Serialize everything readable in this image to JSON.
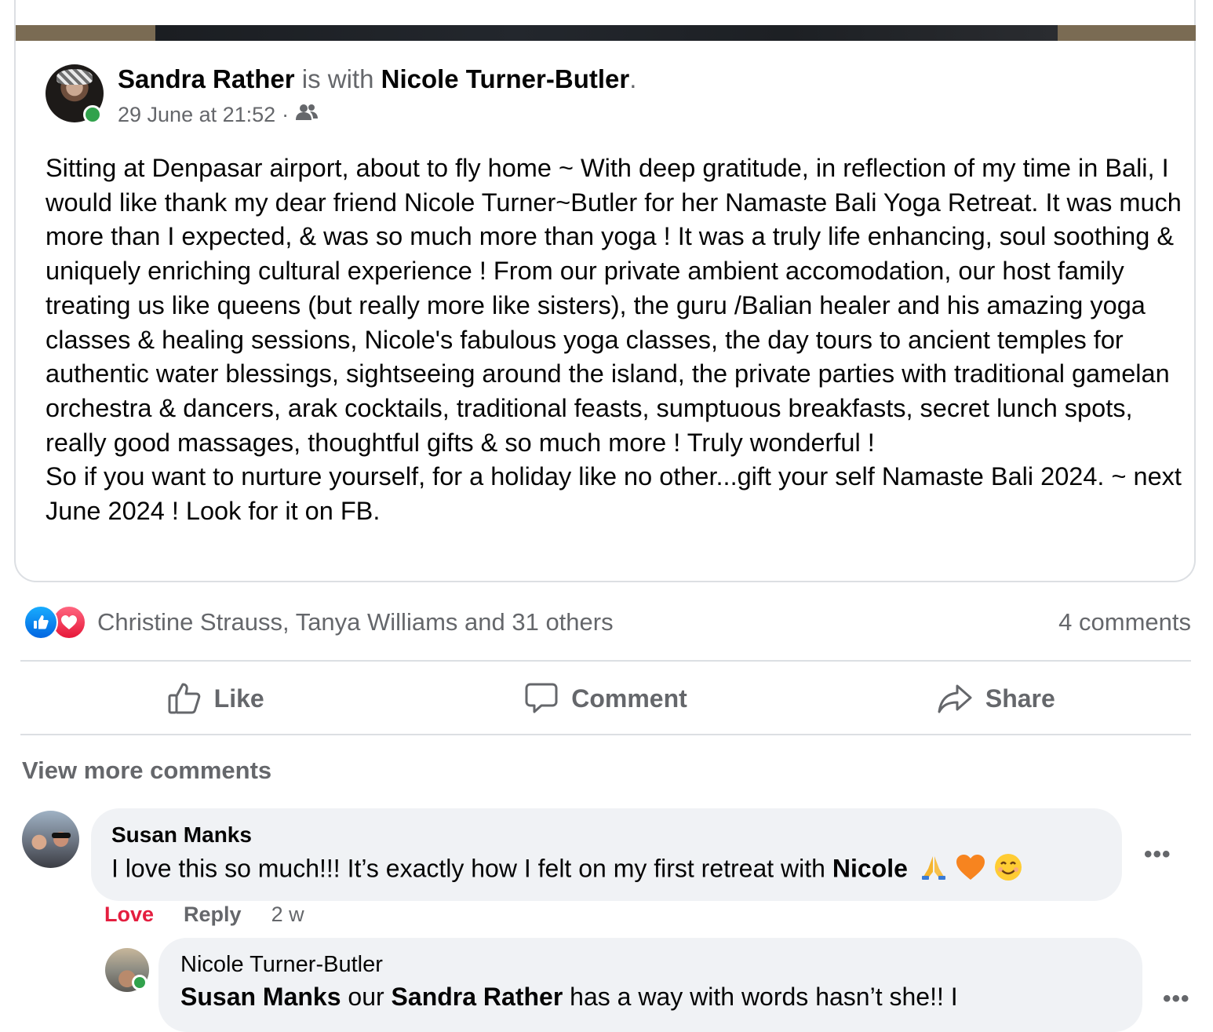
{
  "shared_post": {
    "author": "Sandra Rather",
    "with_text": "is with",
    "tagged": "Nicole Turner-Butler",
    "period": ".",
    "timestamp": "29 June at 21:52",
    "separator": "·",
    "audience_icon": "friends-icon",
    "paragraph_1": "Sitting at Denpasar airport, about to fly home ~ With deep gratitude, in reflection of my time in Bali, I would like thank my dear friend Nicole Turner~Butler for her Namaste Bali Yoga Retreat. It was much more than I expected, & was so much more than yoga ! It was a truly life enhancing, soul soothing & uniquely enriching cultural experience ! From our private ambient accomodation, our host family treating us like queens (but really more like sisters), the guru /Balian healer and his amazing yoga classes & healing sessions, Nicole's fabulous yoga classes, the day tours to ancient temples for authentic water blessings, sightseeing around the island, the private parties with  traditional gamelan orchestra & dancers, arak cocktails, traditional feasts, sumptuous breakfasts, secret lunch spots, really good massages, thoughtful gifts & so much more ! Truly wonderful !",
    "paragraph_2": "So if you want to nurture yourself, for a holiday like no other...gift your self Namaste Bali 2024. ~ next June 2024 ! Look for it on FB."
  },
  "reactions": {
    "icons": [
      "like-reaction-icon",
      "love-reaction-icon"
    ],
    "names": "Christine Strauss, Tanya Williams and 31 others",
    "comment_count": "4 comments"
  },
  "actions": {
    "like": "Like",
    "comment": "Comment",
    "share": "Share"
  },
  "comments_section": {
    "view_more": "View more comments",
    "comments": [
      {
        "author": "Susan Manks",
        "text": "I love this so much!!! It’s exactly how I felt on my first retreat with ",
        "mention": "Nicole",
        "emojis": [
          "folded-hands",
          "orange-heart",
          "smiling-face"
        ],
        "reaction_label": "Love",
        "reply_label": "Reply",
        "time": "2 w",
        "menu": "•••"
      },
      {
        "author": "Nicole Turner-Butler",
        "mention_1": "Susan Manks",
        "text_1": " our ",
        "mention_2": "Sandra Rather",
        "text_2": " has a way with words hasn’t she!! I",
        "menu": "•••"
      }
    ]
  },
  "colors": {
    "like_blue": "#0866ff",
    "love_red": "#e41e3f",
    "online_green": "#31a24c",
    "muted_text": "#65676b",
    "bubble_bg": "#f0f2f5"
  }
}
